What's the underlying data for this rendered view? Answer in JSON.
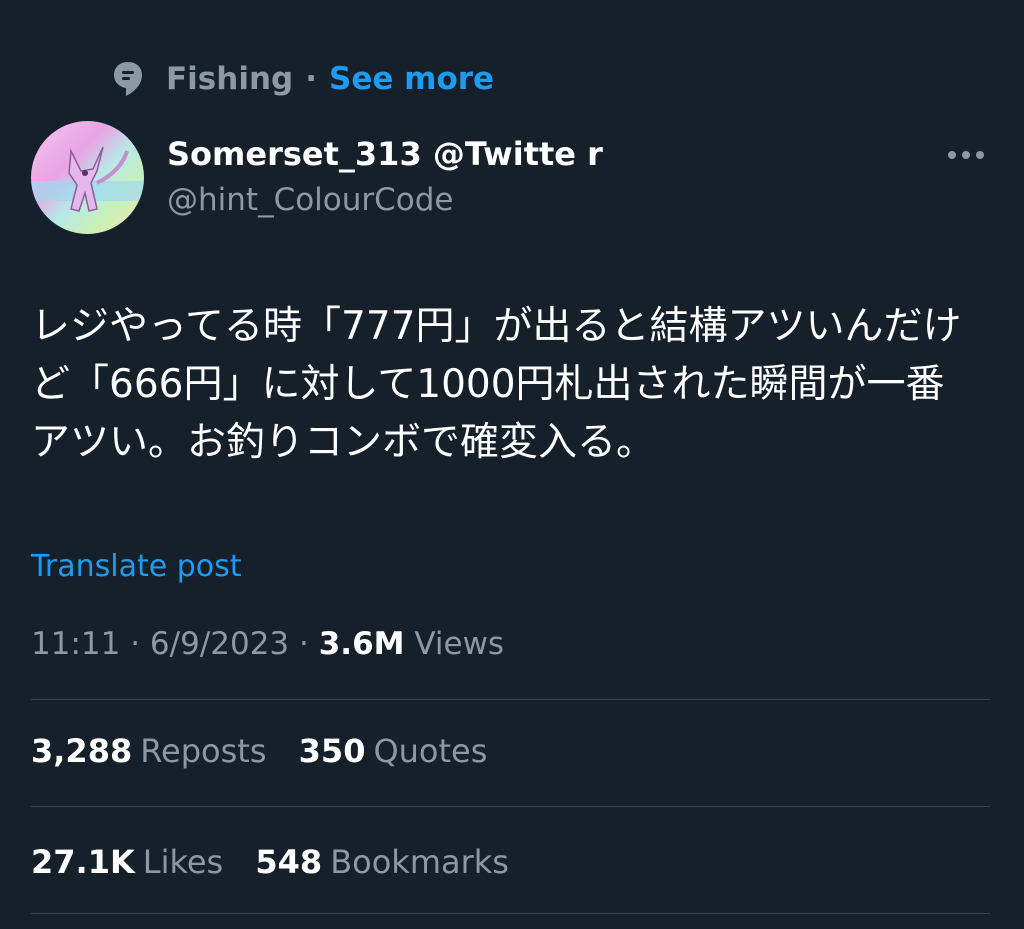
{
  "context": {
    "icon": "topic-icon",
    "topic": "Fishing",
    "separator": "·",
    "see_more": "See more"
  },
  "author": {
    "display_name": "Somerset_313 @Twitte r",
    "handle": "@hint_ColourCode",
    "avatar": "avatar-image"
  },
  "more_icon": "more-icon",
  "post": {
    "text": "レジやってる時「777円」が出ると結構アツいんだけど「666円」に対して1000円札出された瞬間が一番アツい。お釣りコンボで確変入る。",
    "translate_label": "Translate post"
  },
  "meta": {
    "time": "11:11",
    "sep1": "·",
    "date": "6/9/2023",
    "sep2": "·",
    "views_count": "3.6M",
    "views_label": "Views"
  },
  "stats": {
    "reposts_count": "3,288",
    "reposts_label": "Reposts",
    "quotes_count": "350",
    "quotes_label": "Quotes",
    "likes_count": "27.1K",
    "likes_label": "Likes",
    "bookmarks_count": "548",
    "bookmarks_label": "Bookmarks"
  },
  "colors": {
    "background": "#15202b",
    "accent": "#1d9bf0",
    "secondary_text": "#8b98a5",
    "divider": "#38444d"
  }
}
